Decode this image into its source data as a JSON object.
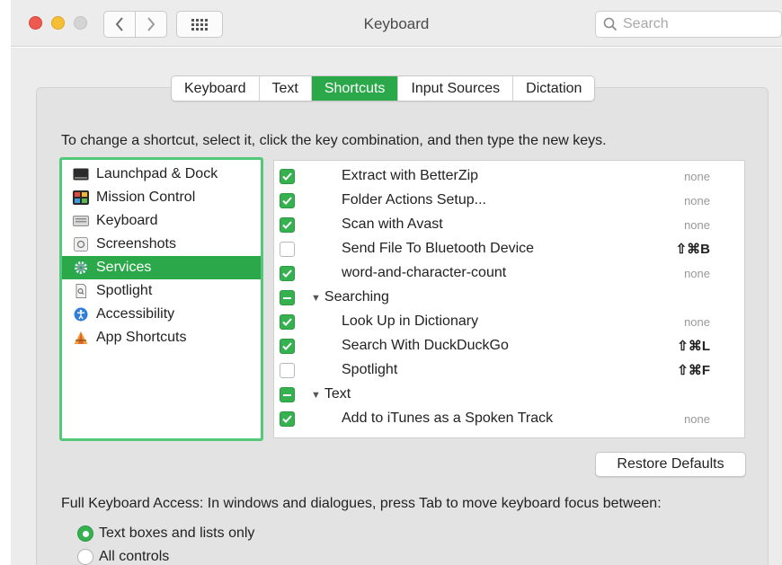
{
  "window": {
    "title": "Keyboard",
    "search_placeholder": "Search"
  },
  "tabs": [
    {
      "label": "Keyboard",
      "active": false
    },
    {
      "label": "Text",
      "active": false
    },
    {
      "label": "Shortcuts",
      "active": true
    },
    {
      "label": "Input Sources",
      "active": false
    },
    {
      "label": "Dictation",
      "active": false
    }
  ],
  "instructions": "To change a shortcut, select it, click the key combination, and then type the new keys.",
  "categories": [
    {
      "label": "Launchpad & Dock",
      "icon": "launchpad-dock-icon"
    },
    {
      "label": "Mission Control",
      "icon": "mission-control-icon"
    },
    {
      "label": "Keyboard",
      "icon": "keyboard-icon"
    },
    {
      "label": "Screenshots",
      "icon": "screenshots-icon"
    },
    {
      "label": "Services",
      "icon": "gear-icon",
      "selected": true
    },
    {
      "label": "Spotlight",
      "icon": "spotlight-icon"
    },
    {
      "label": "Accessibility",
      "icon": "accessibility-icon"
    },
    {
      "label": "App Shortcuts",
      "icon": "app-shortcuts-icon"
    }
  ],
  "shortcuts": [
    {
      "type": "item",
      "checked": "on",
      "name": "Extract with BetterZip",
      "key": "none"
    },
    {
      "type": "item",
      "checked": "on",
      "name": "Folder Actions Setup...",
      "key": "none"
    },
    {
      "type": "item",
      "checked": "on",
      "name": "Scan with Avast",
      "key": "none"
    },
    {
      "type": "item",
      "checked": "off",
      "name": "Send File To Bluetooth Device",
      "key": "⇧⌘B"
    },
    {
      "type": "item",
      "checked": "on",
      "name": "word-and-character-count",
      "key": "none"
    },
    {
      "type": "group",
      "checked": "mixed",
      "name": "Searching"
    },
    {
      "type": "item",
      "checked": "on",
      "name": "Look Up in Dictionary",
      "key": "none"
    },
    {
      "type": "item",
      "checked": "on",
      "name": "Search With DuckDuckGo",
      "key": "⇧⌘L"
    },
    {
      "type": "item",
      "checked": "off",
      "name": "Spotlight",
      "key": "⇧⌘F"
    },
    {
      "type": "group",
      "checked": "mixed",
      "name": "Text"
    },
    {
      "type": "item",
      "checked": "on",
      "name": "Add to iTunes as a Spoken Track",
      "key": "none"
    }
  ],
  "restore_button": "Restore Defaults",
  "full_keyboard_access": {
    "label": "Full Keyboard Access: In windows and dialogues, press Tab to move keyboard focus between:",
    "options": [
      {
        "label": "Text boxes and lists only",
        "selected": true
      },
      {
        "label": "All controls",
        "selected": false
      }
    ]
  },
  "colors": {
    "accent": "#2ba94a",
    "list_highlight_border": "#52c878"
  }
}
